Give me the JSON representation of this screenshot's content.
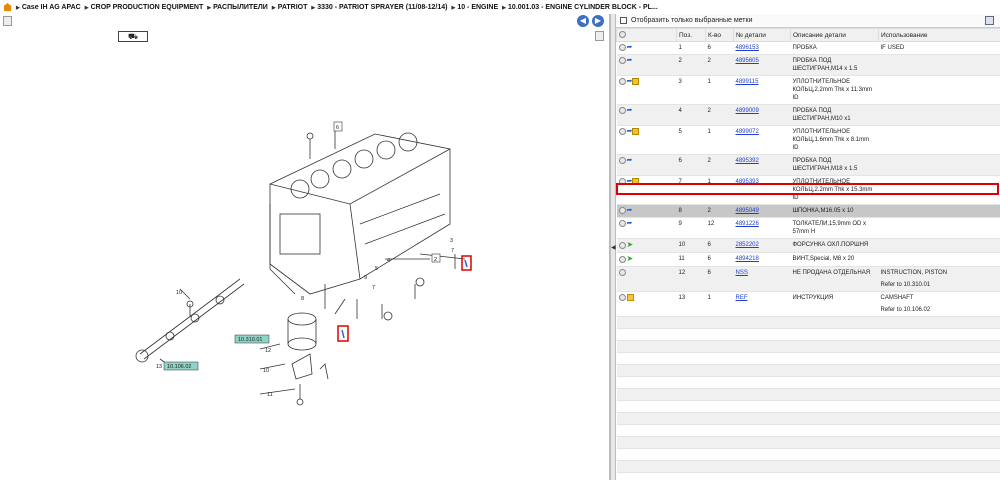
{
  "breadcrumb": [
    "Case IH AG APAC",
    "CROP PRODUCTION EQUIPMENT",
    "РАСПЫЛИТЕЛИ",
    "PATRIOT",
    "3330 - PATRIOT SPRAYER (11/08-12/14)",
    "10 - ENGINE",
    "10.001.03 - ENGINE CYLINDER BLOCK - PL..."
  ],
  "filter": {
    "label": "Отобразить только выбранные метки"
  },
  "table": {
    "headers": [
      "Поз.",
      "К-во",
      "№ детали",
      "Описание детали",
      "Использование"
    ],
    "rows": [
      {
        "pos": "1",
        "qty": "6",
        "part": "4896153",
        "desc": "ПРОБКА",
        "use": "IF USED",
        "icons": "arrow"
      },
      {
        "pos": "2",
        "qty": "2",
        "part": "4895605",
        "desc": "ПРОБКА ПОД ШЕСТИГРАН,M14 x 1.5",
        "use": "",
        "icons": "arrow"
      },
      {
        "pos": "3",
        "qty": "1",
        "part": "4899115",
        "desc": "УПЛОТНИТЕЛЬНОЕ КОЛЬЦ,2.2mm Thk x 11.3mm ID",
        "use": "",
        "icons": "arrow-box"
      },
      {
        "pos": "4",
        "qty": "2",
        "part": "4899009",
        "desc": "ПРОБКА ПОД ШЕСТИГРАН,M10 x1",
        "use": "",
        "icons": "arrow"
      },
      {
        "pos": "5",
        "qty": "1",
        "part": "4899072",
        "desc": "УПЛОТНИТЕЛЬНОЕ КОЛЬЦ,1.6mm Thk x 8.1mm ID",
        "use": "",
        "icons": "arrow-box"
      },
      {
        "pos": "6",
        "qty": "2",
        "part": "4895392",
        "desc": "ПРОБКА ПОД ШЕСТИГРАН,M18 x 1.5",
        "use": "",
        "icons": "arrow"
      },
      {
        "pos": "7",
        "qty": "1",
        "part": "4895393",
        "desc": "УПЛОТНИТЕЛЬНОЕ КОЛЬЦ,2.2mm Thk x 15.3mm ID",
        "use": "",
        "icons": "arrow-box"
      },
      {
        "pos": "8",
        "qty": "2",
        "part": "4895049",
        "desc": "ШПОНКА,M16.05 x 10",
        "use": "",
        "icons": "arrow",
        "selected": true
      },
      {
        "pos": "9",
        "qty": "12",
        "part": "4891226",
        "desc": "ТОЛКАТЕЛИ,15.9mm OD x 57mm H",
        "use": "",
        "icons": "arrow"
      },
      {
        "pos": "10",
        "qty": "6",
        "part": "2852202",
        "desc": "ФОРСУНКА ОХЛ.ПОРШНЯ",
        "use": "",
        "icons": "green"
      },
      {
        "pos": "11",
        "qty": "6",
        "part": "4894218",
        "desc": "ВИНТ,Special, M8 x 20",
        "use": "",
        "icons": "green"
      },
      {
        "pos": "12",
        "qty": "6",
        "part": "NSS",
        "desc": "НЕ ПРОДАНА ОТДЕЛЬНАЯ",
        "use": "INSTRUCTION, PISTON",
        "use2": "Refer to 10.310.01",
        "icons": "none"
      },
      {
        "pos": "13",
        "qty": "1",
        "part": "REF",
        "desc": "ИНСТРУКЦИЯ",
        "use": "CAMSHAFT",
        "use2": "Refer to 10.106.02",
        "icons": "folder"
      }
    ]
  },
  "diagram": {
    "callouts": [
      "1",
      "2",
      "3",
      "4",
      "5",
      "6",
      "7",
      "8",
      "9",
      "10",
      "11",
      "12",
      "13",
      "10.106.02",
      "10.310.01"
    ]
  }
}
